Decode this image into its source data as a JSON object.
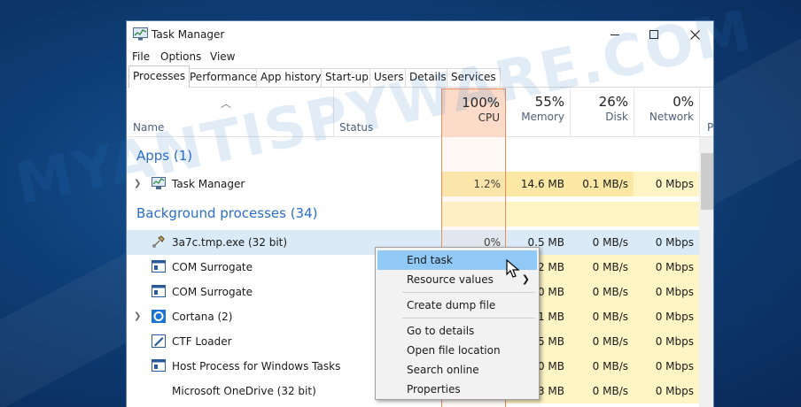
{
  "window": {
    "title": "Task Manager"
  },
  "menu": [
    "File",
    "Options",
    "View"
  ],
  "tabs": [
    "Processes",
    "Performance",
    "App history",
    "Start-up",
    "Users",
    "Details",
    "Services"
  ],
  "headers": {
    "name": "Name",
    "status": "Status",
    "cpu": {
      "pct": "100%",
      "label": "CPU"
    },
    "memory": {
      "pct": "55%",
      "label": "Memory"
    },
    "disk": {
      "pct": "26%",
      "label": "Disk"
    },
    "network": {
      "pct": "0%",
      "label": "Network"
    },
    "power": "P"
  },
  "sections": {
    "apps": "Apps (1)",
    "background": "Background processes (34)"
  },
  "rows": [
    {
      "name": "Task Manager",
      "cpu": "1.2%",
      "memory": "14.6 MB",
      "disk": "0.1 MB/s",
      "network": "0 Mbps"
    },
    {
      "name": "3a7c.tmp.exe (32 bit)",
      "cpu": "0%",
      "memory": "0.5 MB",
      "disk": "0 MB/s",
      "network": "0 Mbps"
    },
    {
      "name": "COM Surrogate",
      "memory": ".2 MB",
      "disk": "0 MB/s",
      "network": "0 Mbps"
    },
    {
      "name": "COM Surrogate",
      "memory": ".0 MB",
      "disk": "0 MB/s",
      "network": "0 Mbps"
    },
    {
      "name": "Cortana (2)",
      "memory": ".1 MB",
      "disk": "0 MB/s",
      "network": "0 Mbps"
    },
    {
      "name": "CTF Loader",
      "memory": ".5 MB",
      "disk": "0 MB/s",
      "network": "0 Mbps"
    },
    {
      "name": "Host Process for Windows Tasks",
      "memory": ".0 MB",
      "disk": "0 MB/s",
      "network": "0 Mbps"
    },
    {
      "name": "Microsoft OneDrive (32 bit)",
      "memory": ".3 MB",
      "disk": "0 MB/s",
      "network": "0 Mbps"
    }
  ],
  "context_menu": [
    "End task",
    "Resource values",
    "Create dump file",
    "Go to details",
    "Open file location",
    "Search online",
    "Properties"
  ],
  "watermark": "MYANTISPYWARE.COM",
  "colors": {
    "accent": "#2a6dc9",
    "cpu_highlight": "#fcdbc8",
    "heat": "#fff4c4",
    "selection": "#90c8f6"
  }
}
